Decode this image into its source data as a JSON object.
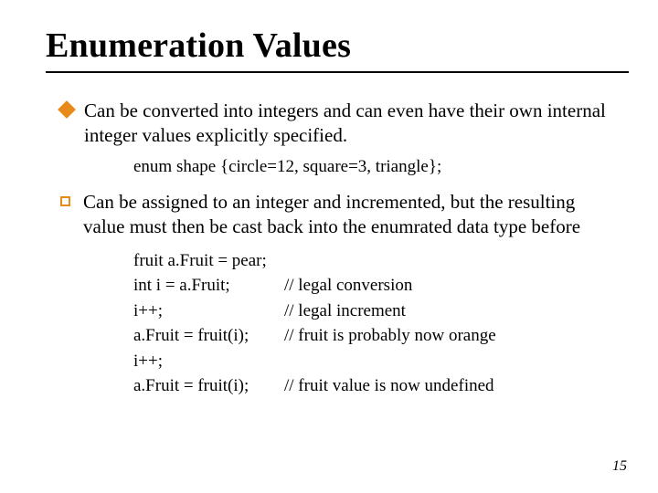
{
  "title": "Enumeration Values",
  "points": [
    {
      "text": "Can be converted into integers and can even have their own internal integer values explicitly specified."
    },
    {
      "text": "Can be assigned to an integer and incremented, but the resulting value must then be cast back into the enumrated data type before"
    }
  ],
  "example1": "enum shape {circle=12, square=3, triangle};",
  "code": [
    {
      "a": "fruit a.Fruit = pear;",
      "b": ""
    },
    {
      "a": "int i = a.Fruit;",
      "b": "// legal conversion"
    },
    {
      "a": "i++;",
      "b": "// legal increment"
    },
    {
      "a": "a.Fruit = fruit(i);",
      "b": "// fruit is probably now orange"
    },
    {
      "a": "i++;",
      "b": ""
    },
    {
      "a": "a.Fruit = fruit(i);",
      "b": "// fruit value is now undefined"
    }
  ],
  "pagenum": "15"
}
